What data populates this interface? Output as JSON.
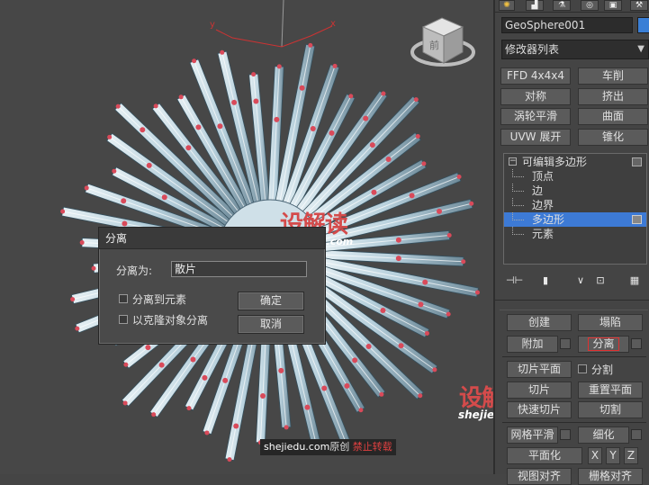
{
  "viewport": {
    "axis_y": "y",
    "axis_x": "x",
    "viewcube_label": "前"
  },
  "panel": {
    "object_name": "GeoSphere001",
    "object_color": "#3a7fd6",
    "modifier_list": "修改器列表",
    "quick_buttons": [
      [
        "FFD 4x4x4",
        "车削"
      ],
      [
        "对称",
        "挤出"
      ],
      [
        "涡轮平滑",
        "曲面"
      ],
      [
        "UVW 展开",
        "锥化"
      ]
    ],
    "stack": {
      "root": "可编辑多边形",
      "items": [
        "顶点",
        "边",
        "边界",
        "多边形",
        "元素"
      ],
      "selected_index": 3
    },
    "edit_geometry": {
      "create": "创建",
      "collapse": "塌陷",
      "attach": "附加",
      "detach": "分离",
      "slice_plane": "切片平面",
      "split": "分割",
      "slice": "切片",
      "reset_plane": "重置平面",
      "quickslice": "快速切片",
      "cut": "切割",
      "meshsmooth": "网格平滑",
      "tessellate": "细化",
      "make_planar": "平面化",
      "x": "X",
      "y": "Y",
      "z": "Z",
      "view_align": "视图对齐",
      "grid_align": "栅格对齐"
    }
  },
  "dialog": {
    "title": "分离",
    "label_detach_as": "分离为:",
    "input_value": "散片",
    "opt_element": "分离到元素",
    "opt_clone": "以克隆对象分离",
    "ok": "确定",
    "cancel": "取消"
  },
  "watermark": {
    "logo": "设解读",
    "domain": "shejiedu.com",
    "credit_site": "shejiedu.com",
    "credit_orig": "原创",
    "credit_forbid": "禁止转载"
  }
}
